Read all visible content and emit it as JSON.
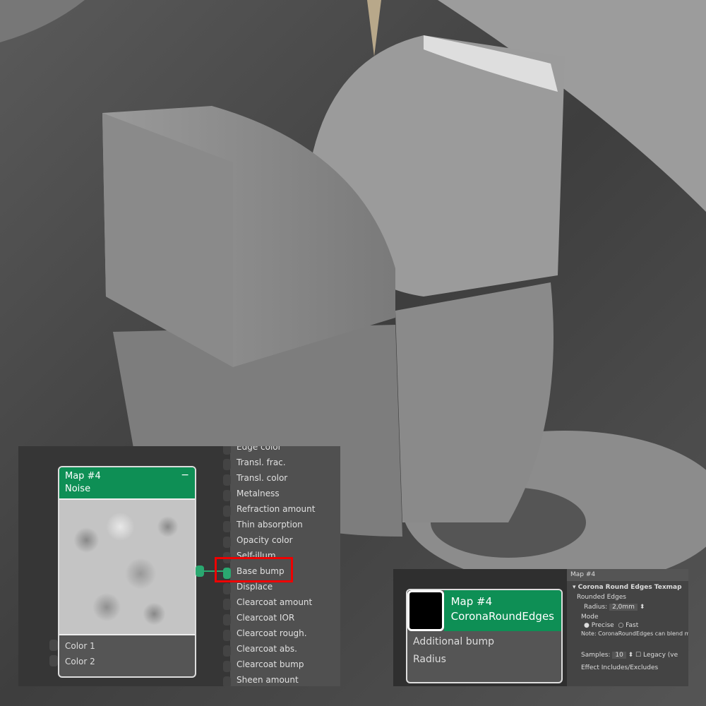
{
  "node_editor_1": {
    "node": {
      "title": "Map #4",
      "subtitle": "Noise",
      "minimize": "−",
      "inputs": [
        "Color 1",
        "Color 2"
      ]
    },
    "material_inputs": [
      "Edge color",
      "Transl. frac.",
      "Transl. color",
      "Metalness",
      "Refraction amount",
      "Thin absorption",
      "Opacity color",
      "Self-illum.",
      "Base bump",
      "Displace",
      "Clearcoat amount",
      "Clearcoat IOR",
      "Clearcoat rough.",
      "Clearcoat abs.",
      "Clearcoat bump",
      "Sheen amount"
    ],
    "highlighted_input": "Base bump",
    "accent": "#0e8f55"
  },
  "node_editor_2": {
    "node": {
      "title": "Map #4",
      "subtitle": "CoronaRoundEdges",
      "inputs": [
        "Additional bump",
        "Radius"
      ]
    }
  },
  "properties": {
    "header": "Map #4",
    "rollout": "Corona Round Edges Texmap",
    "group": "Rounded Edges",
    "radius_label": "Radius:",
    "radius_value": "2,0mm",
    "mode_label": "Mode",
    "mode_options": [
      "Precise",
      "Fast"
    ],
    "mode_selected": "Precise",
    "note": "Note: CoronaRoundEdges can blend mesh elements only in precise mode.",
    "samples_label": "Samples:",
    "samples_value": "10",
    "legacy_label": "Legacy (ve",
    "effect_label": "Effect Includes/Excludes"
  }
}
